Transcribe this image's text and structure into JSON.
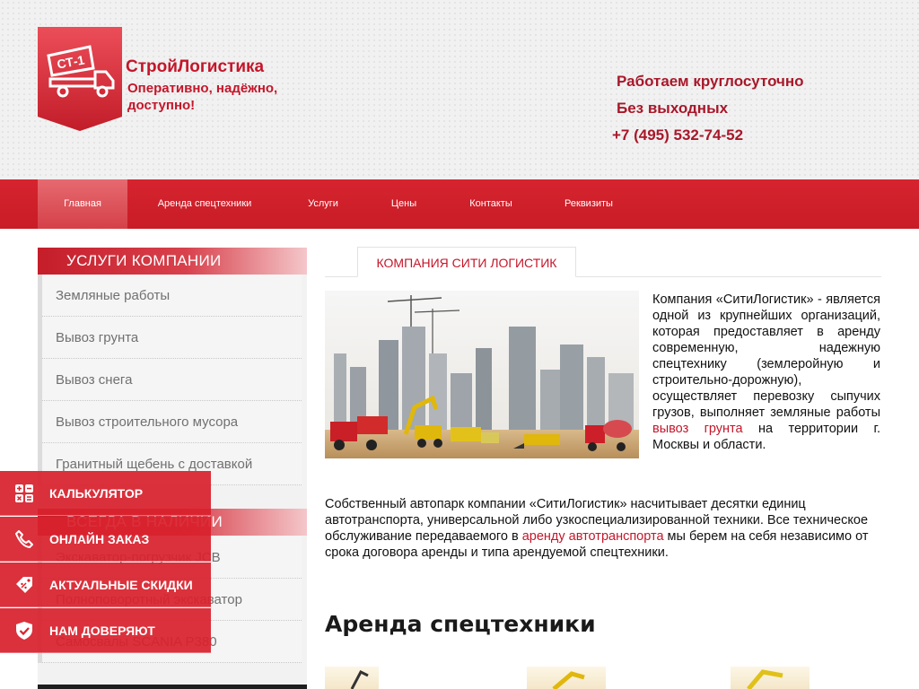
{
  "header": {
    "logo_mark": "СТ-1",
    "brand": "СтройЛогистика",
    "slogan": "Оперативно, надёжно, доступно!",
    "hours": "Работаем круглосуточно",
    "days": "Без выходных",
    "phone": "+7 (495) 532-74-52"
  },
  "nav": {
    "items": [
      {
        "label": "Главная",
        "active": true
      },
      {
        "label": "Аренда спецтехники"
      },
      {
        "label": "Услуги"
      },
      {
        "label": "Цены"
      },
      {
        "label": "Контакты"
      },
      {
        "label": "Реквизиты"
      }
    ]
  },
  "sidebar": {
    "services_title": "УСЛУГИ КОМПАНИИ",
    "services": [
      "Земляные работы",
      "Вывоз грунта",
      "Вывоз снега",
      "Вывоз строительного мусора",
      "Гранитный щебень с доставкой"
    ],
    "stock_title": "ВСЕГДА В НАЛИЧИИ",
    "stock": [
      "Экскаватор-погрузчик JCB",
      "Полноповоротный экскаватор",
      "Самосвалы SCANIA P380"
    ]
  },
  "widget": {
    "items": [
      {
        "label": "КАЛЬКУЛЯТОР",
        "icon": "calculator-icon"
      },
      {
        "label": "ОНЛАЙН ЗАКАЗ",
        "icon": "phone-icon"
      },
      {
        "label": "АКТУАЛЬНЫЕ СКИДКИ",
        "icon": "discount-tag-icon"
      },
      {
        "label": "НАМ ДОВЕРЯЮТ",
        "icon": "shield-check-icon"
      }
    ]
  },
  "content": {
    "tab": "КОМПАНИЯ СИТИ ЛОГИСТИК",
    "intro_text": "Компания «СитиЛогистик» - является одной из крупнейших организаций, которая предоставляет в аренду современную, надежную спецтехнику (землеройную и строительно-дорожную), осуществляет перевозку сыпучих грузов, выполняет земляные работы ",
    "intro_link": "вывоз грунта",
    "intro_tail": " на территории г. Москвы и области.",
    "para_text": "Собственный автопарк компании «СитиЛогистик» насчитывает десятки единиц автотранспорта, универсальной либо узкоспециализированной техники. Все техническое обслуживание передаваемого в ",
    "para_link": "аренду автотранспорта",
    "para_tail": " мы берем на себя независимо от срока договора аренды и типа арендуемой спецтехники.",
    "section_title": "Аренда спецтехники"
  },
  "colors": {
    "brand_red": "#c4162a",
    "nav_red": "#d6242f",
    "dark_red_text": "#a8182a"
  }
}
